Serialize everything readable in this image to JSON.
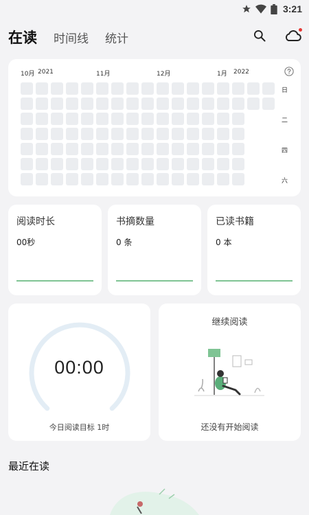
{
  "status_bar": {
    "time": "3:21"
  },
  "header": {
    "tabs": [
      {
        "label": "在读",
        "active": true
      },
      {
        "label": "时间线",
        "active": false
      },
      {
        "label": "统计",
        "active": false
      }
    ]
  },
  "heatmap": {
    "months": [
      "10月",
      "2021",
      "11月",
      "12月",
      "1月",
      "2022"
    ],
    "weekdays": [
      "日",
      "二",
      "四",
      "六"
    ],
    "empty_color": "#ebedf0"
  },
  "stats": [
    {
      "title": "阅读时长",
      "value": "00秒"
    },
    {
      "title": "书摘数量",
      "value": "0 条"
    },
    {
      "title": "已读书籍",
      "value": "0 本"
    }
  ],
  "timer": {
    "display": "00:00",
    "goal_label": "今日阅读目标 1时",
    "progress": 0
  },
  "continue_reading": {
    "title": "继续阅读",
    "empty_text": "还没有开始阅读"
  },
  "recent": {
    "title": "最近在读"
  },
  "colors": {
    "accent_green": "#7fc494",
    "ring_track": "#e3edf5",
    "notification_dot": "#e53935"
  }
}
